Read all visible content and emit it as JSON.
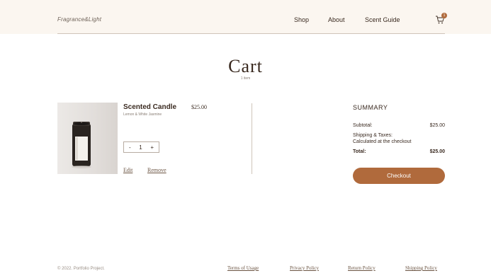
{
  "header": {
    "logo": "Fragrance&Light",
    "nav": [
      "Shop",
      "About",
      "Scent Guide"
    ],
    "cart_badge": "1",
    "background": "#fbf6f0"
  },
  "cart": {
    "title": "Cart",
    "item_count": "1 item"
  },
  "item": {
    "name": "Scented Candle",
    "variant": "Lemon & White Jasmine",
    "price": "$25.00",
    "qty_minus": "-",
    "qty_value": "1",
    "qty_plus": "+",
    "edit_label": "Edit",
    "remove_label": "Remove"
  },
  "summary": {
    "title": "SUMMARY",
    "subtotal_label": "Subtotal:",
    "subtotal_value": "$25.00",
    "shipping_label": "Shipping & Taxes:",
    "shipping_value": "Calculated at the checkout",
    "total_label": "Total:",
    "total_value": "$25.00",
    "checkout_label": "Checkout",
    "accent": "#b06a3c"
  },
  "footer": {
    "copyright": "© 2022. Portfolio Project.",
    "links": [
      "Terms of Usage",
      "Privacy Policy",
      "Return Policy",
      "Shipping Policy"
    ]
  },
  "icons": {
    "cart": "shopping-cart-icon"
  }
}
